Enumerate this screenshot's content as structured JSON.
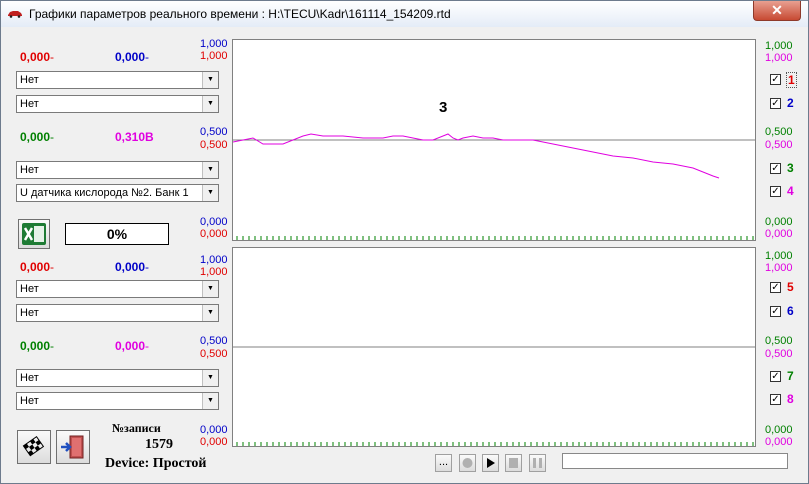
{
  "window": {
    "title": "Графики параметров реального времени : H:\\TECU\\Kadr\\161114_154209.rtd",
    "close_label": "✕"
  },
  "panel1": {
    "v_red": "0,000",
    "v_blue": "0,000",
    "combo1": "Нет",
    "combo2": "Нет",
    "v_green": "0,000",
    "v_magenta": "0,310B",
    "combo3": "Нет",
    "combo4": "U датчика кислорода №2. Банк 1"
  },
  "progress_percent": "0%",
  "panel2": {
    "v_red": "0,000",
    "v_blue": "0,000",
    "combo1": "Нет",
    "combo2": "Нет",
    "v_green": "0,000",
    "v_magenta": "0,000",
    "combo3": "Нет",
    "combo4": "Нет"
  },
  "record": {
    "label": "№записи",
    "number": "1579",
    "device": "Device: Простой"
  },
  "axis": {
    "top": "1,000",
    "mid": "0,500",
    "bot": "0,000"
  },
  "plot1_label": "3",
  "checkboxes": [
    "1",
    "2",
    "3",
    "4",
    "5",
    "6",
    "7",
    "8"
  ],
  "playback": {
    "more_label": "..."
  },
  "colors": {
    "red": "#e00000",
    "blue": "#0000c8",
    "green": "#008000",
    "magenta": "#e000e0"
  },
  "chart_data": {
    "type": "line",
    "series": [
      {
        "x": [
          0,
          20,
          30,
          50,
          70,
          78,
          90,
          110,
          130,
          150,
          160,
          170,
          180,
          190,
          200,
          210,
          215,
          220,
          225,
          230,
          240,
          250,
          260,
          270,
          280,
          300,
          320,
          340,
          360,
          380,
          400,
          420,
          440,
          460,
          470,
          480,
          486
        ],
        "values": [
          0.49,
          0.51,
          0.48,
          0.48,
          0.52,
          0.53,
          0.52,
          0.52,
          0.51,
          0.51,
          0.52,
          0.52,
          0.51,
          0.5,
          0.5,
          0.52,
          0.53,
          0.51,
          0.5,
          0.51,
          0.52,
          0.51,
          0.51,
          0.5,
          0.5,
          0.5,
          0.48,
          0.46,
          0.44,
          0.42,
          0.41,
          0.39,
          0.38,
          0.36,
          0.34,
          0.32,
          0.31
        ]
      }
    ],
    "ylim": [
      0,
      1
    ]
  }
}
